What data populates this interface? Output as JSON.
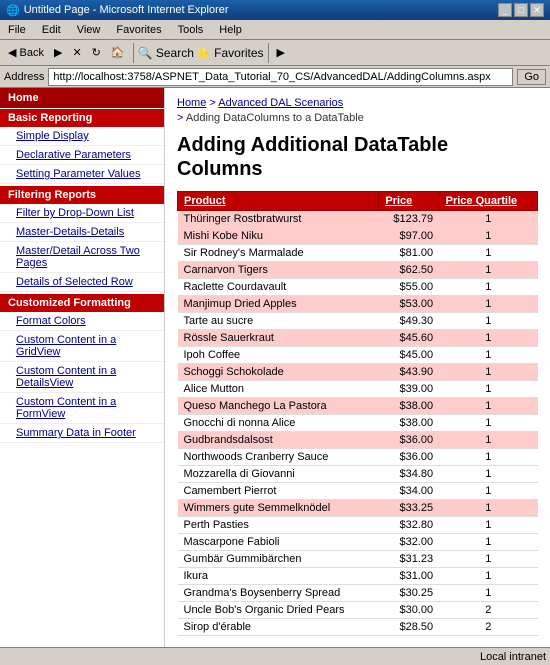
{
  "window": {
    "title": "Untitled Page - Microsoft Internet Explorer"
  },
  "menu": {
    "items": [
      "File",
      "Edit",
      "View",
      "Favorites",
      "Tools",
      "Help"
    ]
  },
  "address": {
    "label": "Address",
    "url": "http://localhost:3758/ASPNET_Data_Tutorial_70_CS/AdvancedDAL/AddingColumns.aspx",
    "go_label": "Go"
  },
  "breadcrumb": {
    "home": "Home",
    "section": "Advanced DAL Scenarios",
    "page": "Adding DataColumns to a DataTable"
  },
  "page": {
    "title": "Adding Additional DataTable Columns"
  },
  "sidebar": {
    "home_label": "Home",
    "sections": [
      {
        "label": "Basic Reporting",
        "items": [
          {
            "id": "simple-display",
            "label": "Simple Display"
          },
          {
            "id": "declarative-parameters",
            "label": "Declarative Parameters"
          },
          {
            "id": "setting-parameter-values",
            "label": "Setting Parameter Values"
          }
        ]
      },
      {
        "label": "Filtering Reports",
        "items": [
          {
            "id": "filter-by-dropdown",
            "label": "Filter by Drop-Down List"
          },
          {
            "id": "master-details",
            "label": "Master-Details-Details"
          },
          {
            "id": "master-detail-across",
            "label": "Master/Detail Across Two Pages"
          },
          {
            "id": "details-selected-row",
            "label": "Details of Selected Row"
          }
        ]
      },
      {
        "label": "Customized Formatting",
        "items": [
          {
            "id": "format-colors",
            "label": "Format Colors"
          },
          {
            "id": "custom-content-gridview",
            "label": "Custom Content in a GridView"
          },
          {
            "id": "custom-content-detailsview",
            "label": "Custom Content in a DetailsView"
          },
          {
            "id": "custom-content-formview",
            "label": "Custom Content in a FormView"
          },
          {
            "id": "summary-data",
            "label": "Summary Data in Footer"
          }
        ]
      }
    ]
  },
  "table": {
    "headers": [
      "Product",
      "Price",
      "Price Quartile"
    ],
    "rows": [
      {
        "product": "Thüringer Rostbratwurst",
        "price": "$123.79",
        "quartile": "1",
        "highlight": true
      },
      {
        "product": "Mishi Kobe Niku",
        "price": "$97.00",
        "quartile": "1",
        "highlight": true
      },
      {
        "product": "Sir Rodney's Marmalade",
        "price": "$81.00",
        "quartile": "1",
        "highlight": false
      },
      {
        "product": "Carnarvon Tigers",
        "price": "$62.50",
        "quartile": "1",
        "highlight": true
      },
      {
        "product": "Raclette Courdavault",
        "price": "$55.00",
        "quartile": "1",
        "highlight": false
      },
      {
        "product": "Manjimup Dried Apples",
        "price": "$53.00",
        "quartile": "1",
        "highlight": true
      },
      {
        "product": "Tarte au sucre",
        "price": "$49.30",
        "quartile": "1",
        "highlight": false
      },
      {
        "product": "Rössle Sauerkraut",
        "price": "$45.60",
        "quartile": "1",
        "highlight": true
      },
      {
        "product": "Ipoh Coffee",
        "price": "$45.00",
        "quartile": "1",
        "highlight": false
      },
      {
        "product": "Schoggi Schokolade",
        "price": "$43.90",
        "quartile": "1",
        "highlight": true
      },
      {
        "product": "Alice Mutton",
        "price": "$39.00",
        "quartile": "1",
        "highlight": false
      },
      {
        "product": "Queso Manchego La Pastora",
        "price": "$38.00",
        "quartile": "1",
        "highlight": true
      },
      {
        "product": "Gnocchi di nonna Alice",
        "price": "$38.00",
        "quartile": "1",
        "highlight": false
      },
      {
        "product": "Gudbrandsdalsost",
        "price": "$36.00",
        "quartile": "1",
        "highlight": true
      },
      {
        "product": "Northwoods Cranberry Sauce",
        "price": "$36.00",
        "quartile": "1",
        "highlight": false
      },
      {
        "product": "Mozzarella di Giovanni",
        "price": "$34.80",
        "quartile": "1",
        "highlight": false
      },
      {
        "product": "Camembert Pierrot",
        "price": "$34.00",
        "quartile": "1",
        "highlight": false
      },
      {
        "product": "Wimmers gute Semmelknödel",
        "price": "$33.25",
        "quartile": "1",
        "highlight": true
      },
      {
        "product": "Perth Pasties",
        "price": "$32.80",
        "quartile": "1",
        "highlight": false
      },
      {
        "product": "Mascarpone Fabioli",
        "price": "$32.00",
        "quartile": "1",
        "highlight": false
      },
      {
        "product": "Gumbär Gummibärchen",
        "price": "$31.23",
        "quartile": "1",
        "highlight": false
      },
      {
        "product": "Ikura",
        "price": "$31.00",
        "quartile": "1",
        "highlight": false
      },
      {
        "product": "Grandma's Boysenberry Spread",
        "price": "$30.25",
        "quartile": "1",
        "highlight": false
      },
      {
        "product": "Uncle Bob's Organic Dried Pears",
        "price": "$30.00",
        "quartile": "2",
        "highlight": false
      },
      {
        "product": "Sirop d'érable",
        "price": "$28.50",
        "quartile": "2",
        "highlight": false
      }
    ]
  },
  "status": {
    "text": "Local intranet"
  }
}
